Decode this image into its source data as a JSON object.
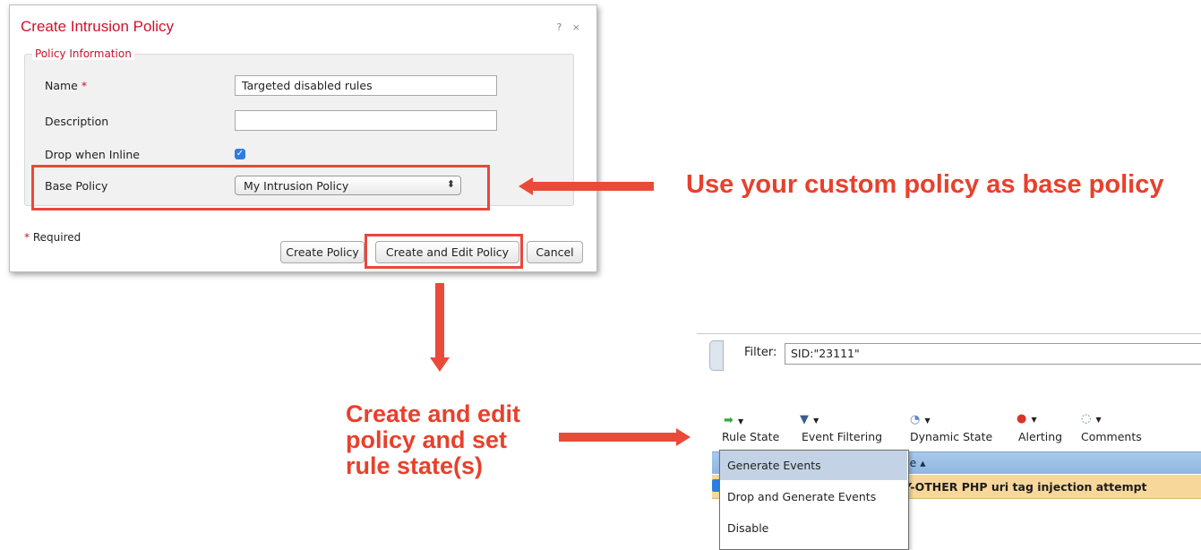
{
  "dialog": {
    "title": "Create Intrusion Policy",
    "controls": "? ×",
    "legend": "Policy Information",
    "name_label": "Name",
    "required_star": "*",
    "name_value": "Targeted disabled rules",
    "description_label": "Description",
    "description_value": "",
    "drop_inline_label": "Drop when Inline",
    "drop_inline_checked": true,
    "base_policy_label": "Base Policy",
    "base_policy_value": "My Intrusion Policy",
    "required_note": "Required",
    "buttons": {
      "create": "Create Policy",
      "create_edit": "Create and Edit Policy",
      "cancel": "Cancel"
    }
  },
  "annotations": {
    "base_policy_note": "Use your custom policy as base policy",
    "edit_note_lines": [
      "Create and edit",
      "policy and set",
      "rule state(s)"
    ]
  },
  "rules_panel": {
    "filter_label": "Filter:",
    "filter_value": "SID:\"23111\"",
    "toolbar": [
      {
        "label": "Rule State",
        "icon": "arrow-right-icon"
      },
      {
        "label": "Event Filtering",
        "icon": "funnel-icon"
      },
      {
        "label": "Dynamic State",
        "icon": "clock-icon"
      },
      {
        "label": "Alerting",
        "icon": "alert-icon"
      },
      {
        "label": "Comments",
        "icon": "speech-bubble-icon"
      }
    ],
    "grid_header_fragment": "age ▴",
    "row_message_fragment": "CY-OTHER PHP uri tag injection attempt",
    "menu_items": [
      "Generate Events",
      "Drop and Generate Events",
      "Disable"
    ],
    "menu_active_index": 0
  },
  "colors": {
    "accent_red": "#d0102b",
    "annotation_red": "#e8402c",
    "highlight_border": "#e9473a",
    "checkbox_blue": "#2f7de1"
  }
}
